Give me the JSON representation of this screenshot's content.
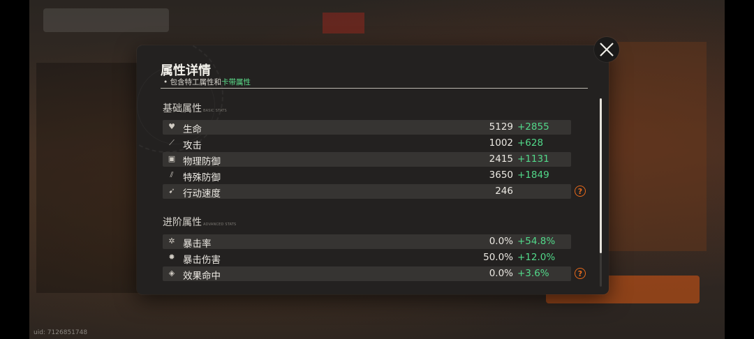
{
  "uid": "uid: 7126851748",
  "panel": {
    "title": "属性详情",
    "subtitle_prefix": "• 包含特工属性和",
    "subtitle_accent": "卡带属性",
    "accent_color": "#5de08c",
    "bonus_color": "#52d98a",
    "help_color": "#e86a1c"
  },
  "basic": {
    "title": "基础属性",
    "title_tag": "BASIC STATS",
    "rows": [
      {
        "icon": "heart-icon",
        "name": "生命",
        "base": "5129",
        "bonus": "+2855"
      },
      {
        "icon": "sword-icon",
        "name": "攻击",
        "base": "1002",
        "bonus": "+628"
      },
      {
        "icon": "shield-icon",
        "name": "物理防御",
        "base": "2415",
        "bonus": "+1131"
      },
      {
        "icon": "special-shield-icon",
        "name": "特殊防御",
        "base": "3650",
        "bonus": "+1849"
      },
      {
        "icon": "boot-icon",
        "name": "行动速度",
        "base": "246",
        "bonus": ""
      }
    ]
  },
  "advanced": {
    "title": "进阶属性",
    "title_tag": "ADVANCED STATS",
    "rows": [
      {
        "icon": "crit-icon",
        "name": "暴击率",
        "base": "0.0%",
        "bonus": "+54.8%"
      },
      {
        "icon": "crit-damage-icon",
        "name": "暴击伤害",
        "base": "50.0%",
        "bonus": "+12.0%"
      },
      {
        "icon": "effect-hit-icon",
        "name": "效果命中",
        "base": "0.0%",
        "bonus": "+3.6%"
      }
    ]
  },
  "help_label": "?"
}
